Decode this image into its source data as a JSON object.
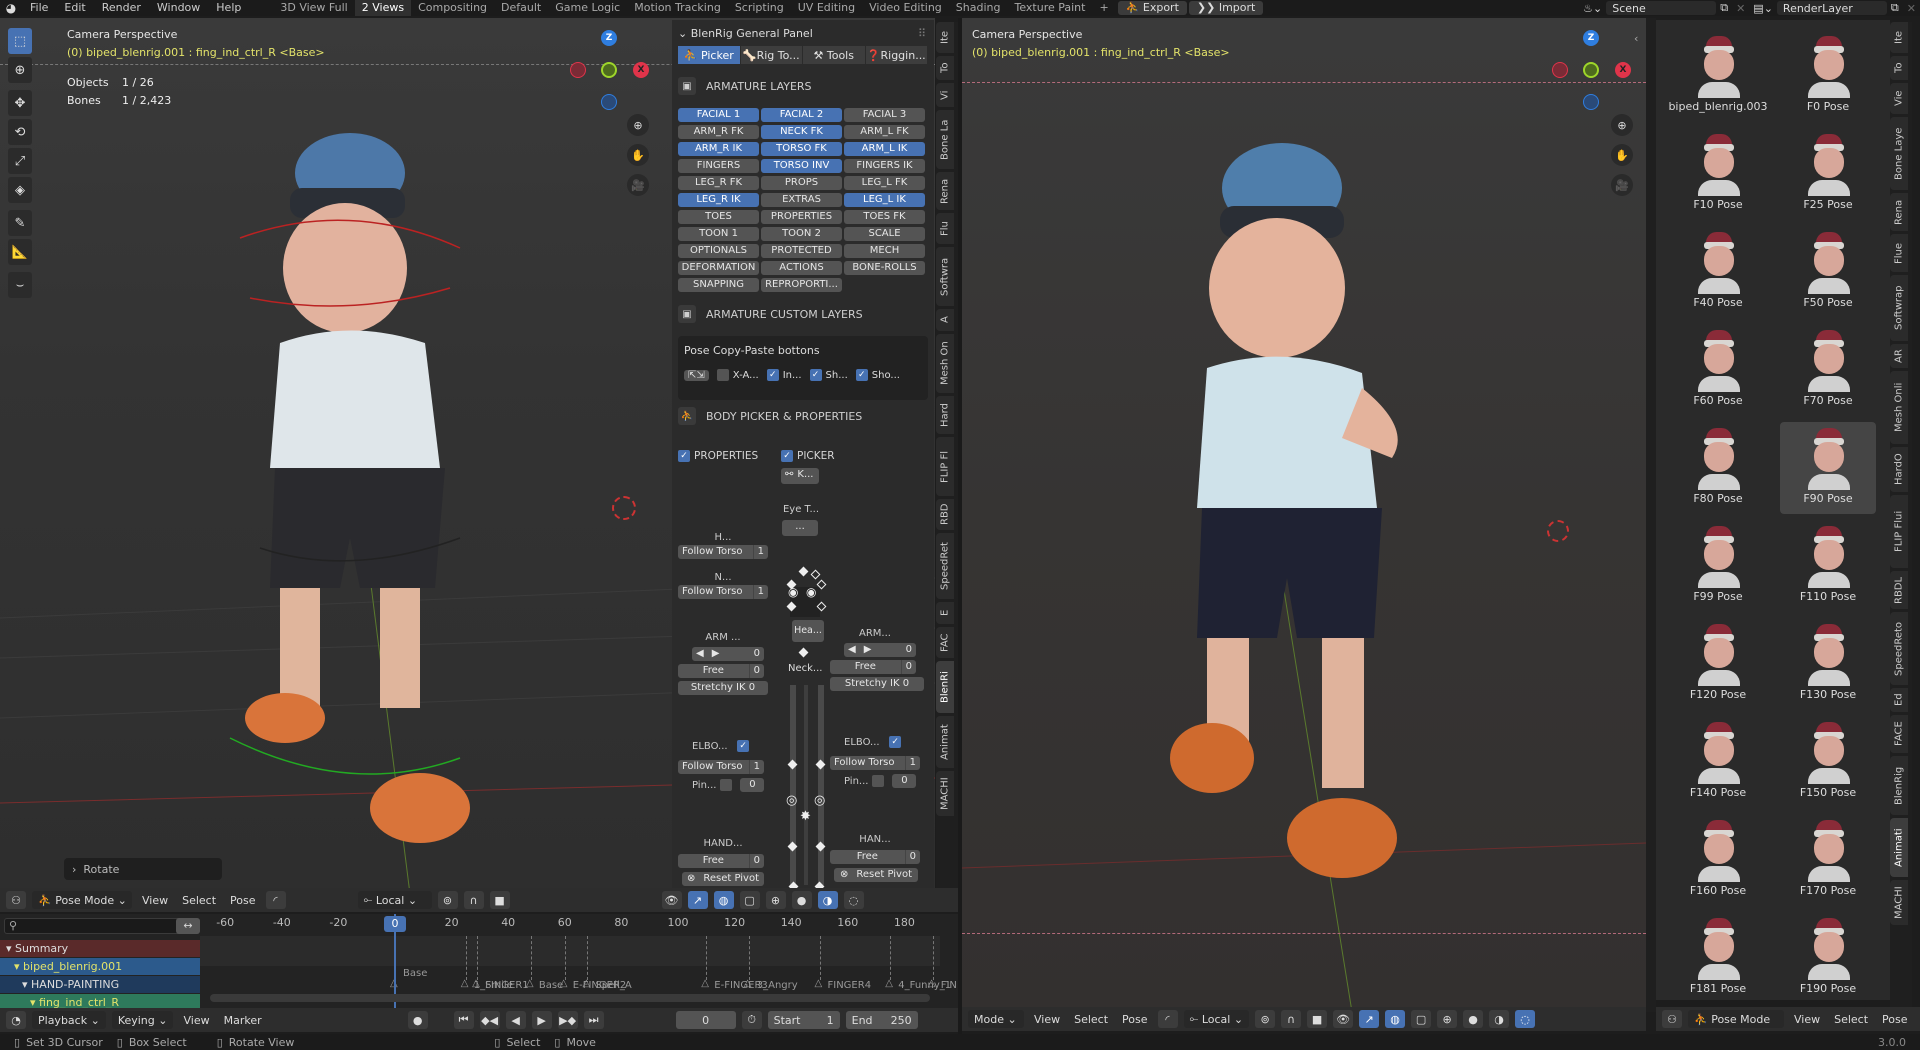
{
  "topbar": {
    "menus": [
      "File",
      "Edit",
      "Render",
      "Window",
      "Help"
    ],
    "workspaces": [
      "3D View Full",
      "2 Views",
      "Compositing",
      "Default",
      "Game Logic",
      "Motion Tracking",
      "Scripting",
      "UV Editing",
      "Video Editing",
      "Shading",
      "Texture Paint"
    ],
    "active_workspace": "2 Views",
    "add_workspace": "+",
    "export_label": "Export",
    "import_label": "Import",
    "scene": "Scene",
    "render_layer": "RenderLayer"
  },
  "left_viewport": {
    "view_name": "Camera Perspective",
    "active_info": "(0) biped_blenrig.001 : fing_ind_ctrl_R <Base>",
    "stats": [
      {
        "label": "Objects",
        "value": "1 / 26"
      },
      {
        "label": "Bones",
        "value": "1 / 2,423"
      }
    ],
    "last_operator": "Rotate",
    "tools": [
      "select-box",
      "cursor",
      "move",
      "rotate",
      "scale",
      "transform",
      "annotate",
      "measure",
      "relax"
    ]
  },
  "npanel": {
    "title": "BlenRig General Panel",
    "tabs": [
      {
        "label": "Picker",
        "active": true
      },
      {
        "label": "Rig To...",
        "active": false
      },
      {
        "label": "Tools",
        "active": false
      },
      {
        "label": "Riggin...",
        "active": false
      }
    ],
    "armature_layers_title": "ARMATURE LAYERS",
    "layers": [
      {
        "label": "FACIAL 1",
        "on": true
      },
      {
        "label": "FACIAL 2",
        "on": true
      },
      {
        "label": "FACIAL 3",
        "on": false
      },
      {
        "label": "ARM_R FK",
        "on": false
      },
      {
        "label": "NECK FK",
        "on": true
      },
      {
        "label": "ARM_L FK",
        "on": false
      },
      {
        "label": "ARM_R IK",
        "on": true
      },
      {
        "label": "TORSO FK",
        "on": true
      },
      {
        "label": "ARM_L IK",
        "on": true
      },
      {
        "label": "FINGERS",
        "on": false
      },
      {
        "label": "TORSO INV",
        "on": true
      },
      {
        "label": "FINGERS IK",
        "on": false
      },
      {
        "label": "LEG_R FK",
        "on": false
      },
      {
        "label": "PROPS",
        "on": false
      },
      {
        "label": "LEG_L FK",
        "on": false
      },
      {
        "label": "LEG_R IK",
        "on": true
      },
      {
        "label": "EXTRAS",
        "on": false
      },
      {
        "label": "LEG_L IK",
        "on": true
      },
      {
        "label": "TOES",
        "on": false
      },
      {
        "label": "PROPERTIES",
        "on": false
      },
      {
        "label": "TOES FK",
        "on": false
      },
      {
        "label": "TOON 1",
        "on": false
      },
      {
        "label": "TOON 2",
        "on": false
      },
      {
        "label": "SCALE",
        "on": false
      },
      {
        "label": "OPTIONALS",
        "on": false
      },
      {
        "label": "PROTECTED",
        "on": false
      },
      {
        "label": "MECH",
        "on": false
      },
      {
        "label": "DEFORMATION",
        "on": false
      },
      {
        "label": "ACTIONS",
        "on": false
      },
      {
        "label": "BONE-ROLLS",
        "on": false
      },
      {
        "label": "SNAPPING",
        "on": false
      },
      {
        "label": "REPROPORTI...",
        "on": false
      }
    ],
    "custom_layers_title": "ARMATURE CUSTOM LAYERS",
    "copy_paste": {
      "title": "Pose Copy-Paste bottons",
      "options": [
        {
          "label": "X-A...",
          "checked": false
        },
        {
          "label": "In...",
          "checked": true
        },
        {
          "label": "Sh...",
          "checked": true
        },
        {
          "label": "Sho...",
          "checked": true
        }
      ]
    },
    "body_picker_title": "BODY PICKER & PROPERTIES",
    "properties_label": "PROPERTIES",
    "picker_label": "PICKER",
    "k_button": "K...",
    "eye_label": "Eye T...",
    "eye_value": "...",
    "head": {
      "label": "H...",
      "field": "Follow Torso",
      "value": "1"
    },
    "neck": {
      "label": "N...",
      "field": "Follow Torso",
      "value": "1"
    },
    "head_btn": "Hea...",
    "neck_btn": "Neck...",
    "arm_r": {
      "label": "ARM ...",
      "switch_value": "0",
      "free_label": "Free",
      "free_value": "0",
      "stretchy": "Stretchy IK 0"
    },
    "arm_l": {
      "label": "ARM...",
      "switch_value": "0",
      "free_label": "Free",
      "free_value": "0",
      "stretchy": "Stretchy IK 0"
    },
    "elbow_r": {
      "label": "ELBO...",
      "checked": true,
      "field": "Follow Torso",
      "value": "1",
      "pin": "Pin...",
      "pin_value": "0"
    },
    "elbow_l": {
      "label": "ELBO...",
      "checked": true,
      "field": "Follow Torso",
      "value": "1",
      "pin": "Pin...",
      "pin_value": "0"
    },
    "hand_r": {
      "label": "HAND...",
      "free_label": "Free",
      "free_value": "0",
      "reset": "Reset Pivot"
    },
    "hand_l": {
      "label": "HAN...",
      "free_label": "Free",
      "free_value": "0",
      "reset": "Reset Pivot"
    }
  },
  "mid_tabs": [
    "Ite",
    "To",
    "Vi",
    "Bone La",
    "Rena",
    "Flu",
    "Softwra",
    "A",
    "Mesh On",
    "Hard",
    "FLIP Fl",
    "RBD",
    "SpeedRet",
    "E",
    "FAC",
    "BlenRi",
    "Animat",
    "MACHI"
  ],
  "mid_tab_active": "BlenRi",
  "right_viewport": {
    "view_name": "Camera Perspective",
    "active_info": "(0) biped_blenrig.001 : fing_ind_ctrl_R <Base>"
  },
  "shelf": {
    "items": [
      "biped_blenrig.003",
      "F0 Pose",
      "F10 Pose",
      "F25 Pose",
      "F40 Pose",
      "F50 Pose",
      "F60 Pose",
      "F70 Pose",
      "F80 Pose",
      "F90 Pose",
      "F99 Pose",
      "F110 Pose",
      "F120 Pose",
      "F130 Pose",
      "F140 Pose",
      "F150 Pose",
      "F160 Pose",
      "F170 Pose",
      "F181 Pose",
      "F190 Pose"
    ],
    "selected": "F90 Pose"
  },
  "right_tabs": [
    "Ite",
    "To",
    "Vie",
    "Bone Laye",
    "Rena",
    "Flue",
    "Softwrap",
    "AR",
    "Mesh Onli",
    "HardO",
    "FLIP Flui",
    "RBDL",
    "SpeedReto",
    "Ed",
    "FACE",
    "BlenRig",
    "Animati",
    "MACHI"
  ],
  "right_tab_active": "Animati",
  "left_header": {
    "mode": "Pose Mode",
    "menus": [
      "View",
      "Select",
      "Pose"
    ],
    "orientation": "Local"
  },
  "right_header": {
    "mode": "Mode",
    "menus": [
      "View",
      "Select",
      "Pose"
    ],
    "orientation": "Local"
  },
  "shelf_header": {
    "mode": "Pose Mode",
    "menus": [
      "View",
      "Select",
      "Pose"
    ]
  },
  "timeline": {
    "ticks": [
      -60,
      -40,
      -20,
      0,
      20,
      40,
      60,
      80,
      100,
      120,
      140,
      160,
      180
    ],
    "current_frame": "0",
    "channels": [
      {
        "label": "Summary",
        "type": "summary"
      },
      {
        "label": "biped_blenrig.001",
        "type": "object"
      },
      {
        "label": "HAND-PAINTING",
        "type": "action"
      },
      {
        "label": "fing_ind_ctrl_R",
        "type": "bone"
      }
    ],
    "markers": [
      {
        "frame": 0,
        "label": "Base"
      },
      {
        "frame": 25,
        "label": "1_FINGER1"
      },
      {
        "frame": 29,
        "label": "Smile"
      },
      {
        "frame": 48,
        "label": "Base"
      },
      {
        "frame": 60,
        "label": "E-FINGER2"
      },
      {
        "frame": 68,
        "label": "Spell_A"
      },
      {
        "frame": 110,
        "label": "E-FINGER3"
      },
      {
        "frame": 125,
        "label": "3_Angry"
      },
      {
        "frame": 150,
        "label": "FINGER4"
      },
      {
        "frame": 175,
        "label": "4_Funny_1"
      },
      {
        "frame": 190,
        "label": "FIN"
      }
    ],
    "menus": [
      "Playback",
      "Keying",
      "View",
      "Marker"
    ],
    "frame_field": "0",
    "start_label": "Start",
    "start_value": "1",
    "end_label": "End",
    "end_value": "250"
  },
  "statusbar": {
    "hints": [
      "Set 3D Cursor",
      "Box Select",
      "Rotate View",
      "Select",
      "Move"
    ],
    "version": "3.0.0"
  },
  "colors": {
    "accent": "#4772b3",
    "active_text": "#e3e36a",
    "summary": "#5a2a2a",
    "object_row": "#2c5a8c",
    "action_row": "#1f3a5c",
    "bone_row": "#2e7a5c"
  }
}
